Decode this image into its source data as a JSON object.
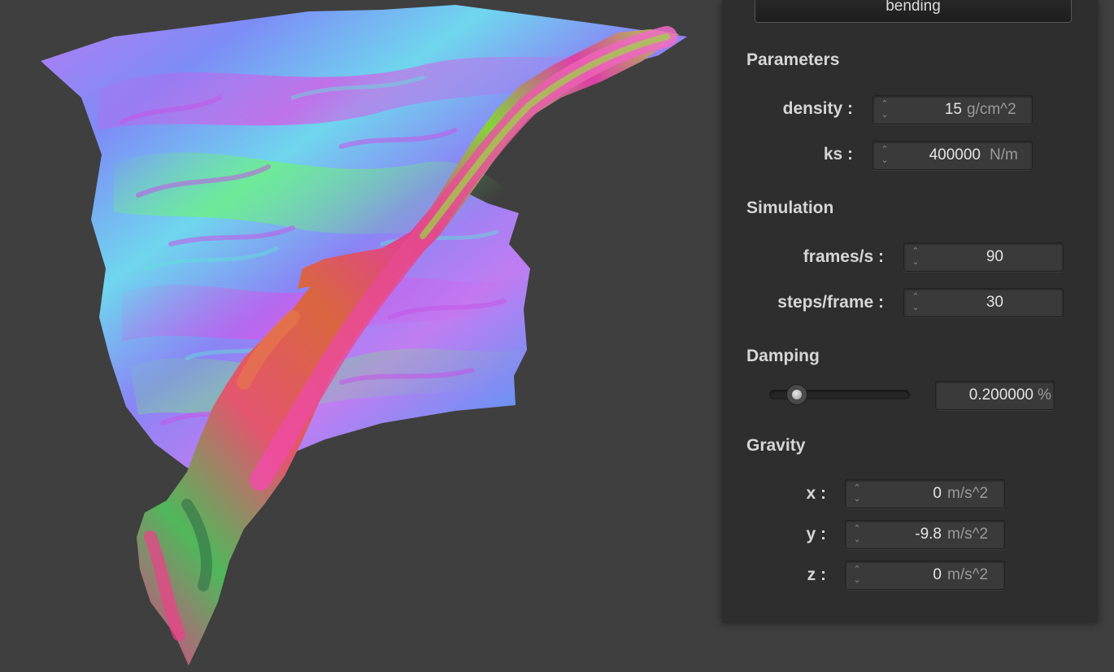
{
  "mode_button": "bending",
  "sections": {
    "parameters": "Parameters",
    "simulation": "Simulation",
    "damping": "Damping",
    "gravity": "Gravity"
  },
  "parameters": {
    "density": {
      "label": "density :",
      "value": "15",
      "unit": "g/cm^2"
    },
    "ks": {
      "label": "ks :",
      "value": "400000",
      "unit": "N/m"
    }
  },
  "simulation": {
    "fps": {
      "label": "frames/s :",
      "value": "90"
    },
    "steps": {
      "label": "steps/frame :",
      "value": "30"
    }
  },
  "damping": {
    "value": "0.200000",
    "unit": "%",
    "slider_level": 0.2
  },
  "gravity": {
    "x": {
      "label": "x :",
      "value": "0",
      "unit": "m/s^2"
    },
    "y": {
      "label": "y :",
      "value": "-9.8",
      "unit": "m/s^2"
    },
    "z": {
      "label": "z :",
      "value": "0",
      "unit": "m/s^2"
    }
  },
  "colors": {
    "background": "#3f3f3f",
    "panel": "#2e2e2e",
    "cloth_blue": "#7f7ff5",
    "cloth_magenta": "#e44ce8",
    "cloth_green": "#63f06a",
    "cloth_red": "#e43a6a"
  }
}
